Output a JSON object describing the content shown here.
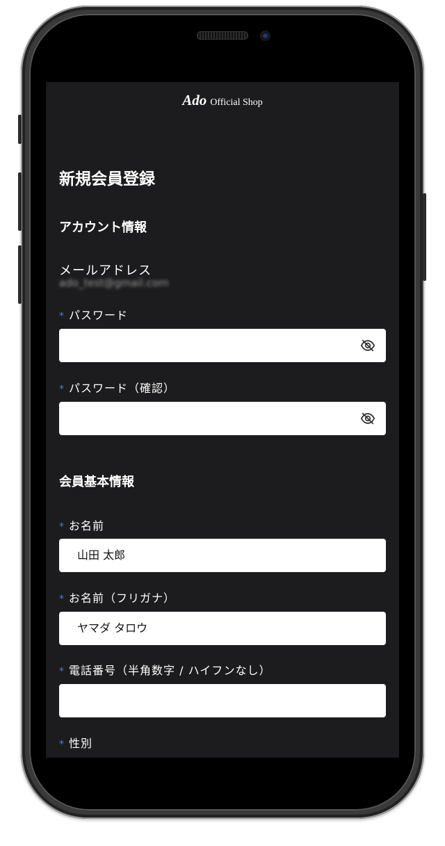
{
  "brand": {
    "logo": "Ado",
    "subtitle": "Official Shop"
  },
  "page_title": "新規会員登録",
  "account_section": {
    "heading": "アカウント情報",
    "email_label": "メールアドレス",
    "email_value": "ado_test@gmail.com",
    "password_label": "パスワード",
    "password_value": "",
    "password_confirm_label": "パスワード（確認）",
    "password_confirm_value": ""
  },
  "member_section": {
    "heading": "会員基本情報",
    "name_label": "お名前",
    "name_value": "山田 太郎",
    "kana_label": "お名前（フリガナ）",
    "kana_value": "ヤマダ タロウ",
    "phone_label": "電話番号（半角数字 / ハイフンなし）",
    "phone_value": "",
    "gender_label": "性別"
  },
  "required_mark": "*",
  "icons": {
    "password_toggle": "eye-slash-icon"
  },
  "colors": {
    "screen_bg": "#1c1c1e",
    "required_mark": "#3f7fe8",
    "input_bg": "#ffffff"
  }
}
